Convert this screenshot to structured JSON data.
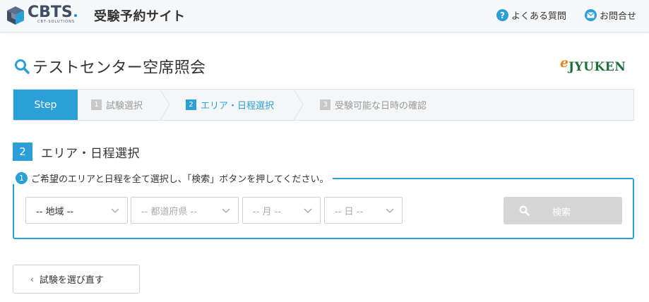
{
  "header": {
    "logo_text": "CBTS",
    "logo_sub": "CBT-SOLUTIONS",
    "site_title": "受験予約サイト",
    "faq_icon": "question-circle-icon",
    "faq_label": "よくある質問",
    "contact_icon": "mail-icon",
    "contact_label": "お問合せ"
  },
  "page": {
    "title_icon": "search-icon",
    "title": "テストセンター空席照会",
    "partner_logo_e": "e",
    "partner_logo_text": "JYUKEN"
  },
  "steps": {
    "head_label": "Step",
    "items": [
      {
        "num": "1",
        "label": "試験選択",
        "active": false
      },
      {
        "num": "2",
        "label": "エリア・日程選択",
        "active": true
      },
      {
        "num": "3",
        "label": "受験可能な日時の確認",
        "active": false
      }
    ]
  },
  "section": {
    "num": "2",
    "title": "エリア・日程選択"
  },
  "form": {
    "instruction_num": "1",
    "instruction": "ご希望のエリアと日程を全て選択し、「検索」ボタンを押してください。",
    "selects": [
      {
        "value": "-- 地域 --",
        "enabled": true
      },
      {
        "value": "-- 都道府県 --",
        "enabled": false
      },
      {
        "value": "-- 月 --",
        "enabled": false
      },
      {
        "value": "-- 日 --",
        "enabled": false
      }
    ],
    "search_label": "検索",
    "search_enabled": false
  },
  "footer": {
    "back_label": "試験を選び直す"
  },
  "colors": {
    "accent": "#2b9fd8",
    "disabled_button": "#d6d6d6",
    "brand_dark": "#3f4e66",
    "jyuken_green": "#1d6f3a",
    "jyuken_orange": "#e8841c"
  }
}
